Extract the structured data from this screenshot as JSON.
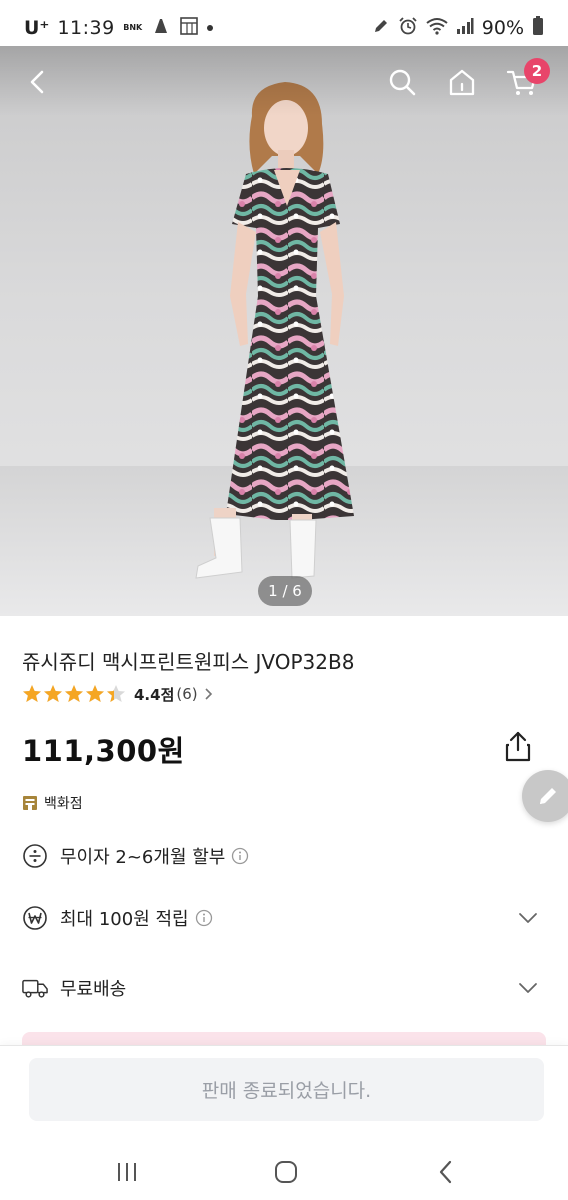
{
  "status_bar": {
    "carrier": "U⁺",
    "time": "11:39",
    "mini_label": "BNK",
    "battery": "90%"
  },
  "hero": {
    "page_indicator": "1 / 6",
    "cart_count": "2"
  },
  "product": {
    "title": "쥬시쥬디 맥시프린트원피스 JVOP32B8",
    "rating_value": 4.4,
    "rating_label": "4.4점",
    "review_count": "(6)",
    "price": "111,300원",
    "store_label": "백화점"
  },
  "info_rows": {
    "installment": "무이자 2~6개월 할부",
    "points": "최대 100원 적립",
    "delivery": "무료배송"
  },
  "bottom": {
    "soldout_label": "판매 종료되었습니다."
  },
  "colors": {
    "accent_pink": "#e8456a",
    "star_gold": "#f5a623",
    "disabled_text": "#9a9ea6"
  }
}
